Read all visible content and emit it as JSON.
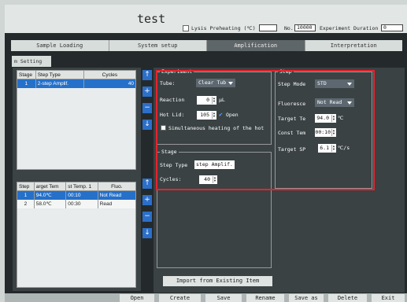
{
  "window": {
    "title": "test",
    "lysis_preheating_label": "Lysis Preheating (℃)",
    "lysis_preheating_value": "",
    "no_label": "No.",
    "no_value": "10000",
    "experiment_duration_label": "Experiment Duration",
    "experiment_duration_value": "0"
  },
  "tabs": [
    "Sample Loading",
    "System setup",
    "Amplification",
    "Interpretation"
  ],
  "active_tab": "Amplification",
  "sub_tab": "m Setting",
  "stage_table": {
    "headers": [
      "Stage",
      "Step Type",
      "Cycles"
    ],
    "rows": [
      [
        "1",
        "2-step Amplif.",
        "40"
      ]
    ]
  },
  "step_table": {
    "headers": [
      "Step",
      "arget Tem",
      "st Temp. 1",
      "Fluo."
    ],
    "rows": [
      [
        "1",
        "94.0℃",
        "00:10",
        "Not Read"
      ],
      [
        "2",
        "58.0℃",
        "00:30",
        "Read"
      ]
    ]
  },
  "arrow_buttons": {
    "up": "↑",
    "add": "+",
    "remove": "−",
    "down": "↓"
  },
  "experiment": {
    "legend": "Experiment",
    "tube_label": "Tube:",
    "tube_value": "Clear Tub",
    "reaction_label": "Reaction",
    "reaction_value": "0",
    "reaction_unit": "μL",
    "hotlid_label": "Hot Lid:",
    "hotlid_value": "105",
    "hotlid_open_label": "Open",
    "simultaneous_label": "Simultaneous heating of the hot"
  },
  "step": {
    "legend": "Step",
    "mode_label": "Step Mode",
    "mode_value": "STD",
    "fluoresce_label": "Fluoresce",
    "fluoresce_value": "Not Read",
    "target_te_label": "Target Te",
    "target_te_value": "94.0",
    "target_te_unit": "℃",
    "const_tem_label": "Const Tem",
    "const_tem_value": "00:10",
    "target_sp_label": "Target SP",
    "target_sp_value": "6.1",
    "target_sp_unit": "℃/s"
  },
  "stage": {
    "legend": "Stage",
    "step_type_label": "Step Type",
    "step_type_value": "step Amplif.",
    "cycles_label": "Cycles:",
    "cycles_value": "40"
  },
  "import_button": "Import from Existing Item",
  "bottom_buttons": [
    "Open",
    "Create",
    "Save",
    "Rename",
    "Save as",
    "Delete",
    "Exit"
  ],
  "colors": {
    "highlight_box": "#e8232c",
    "selected_row": "#2570c9",
    "accent_button": "#2b6fc9"
  }
}
